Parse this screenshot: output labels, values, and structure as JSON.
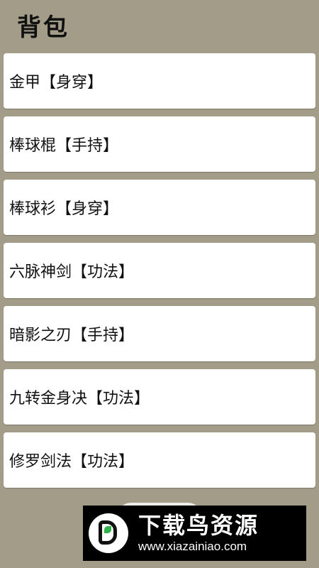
{
  "header": {
    "title": "背包"
  },
  "inventory": {
    "items": [
      {
        "label": "金甲【身穿】"
      },
      {
        "label": "棒球棍【手持】"
      },
      {
        "label": "棒球衫【身穿】"
      },
      {
        "label": "六脉神剑【功法】"
      },
      {
        "label": "暗影之刃【手持】"
      },
      {
        "label": "九转金身决【功法】"
      },
      {
        "label": "修罗剑法【功法】"
      }
    ]
  },
  "watermark": {
    "name": "下载鸟资源",
    "url": "www.xiazainiao.com"
  },
  "colors": {
    "background": "#a29c88",
    "card": "#ffffff",
    "text": "#111111"
  }
}
